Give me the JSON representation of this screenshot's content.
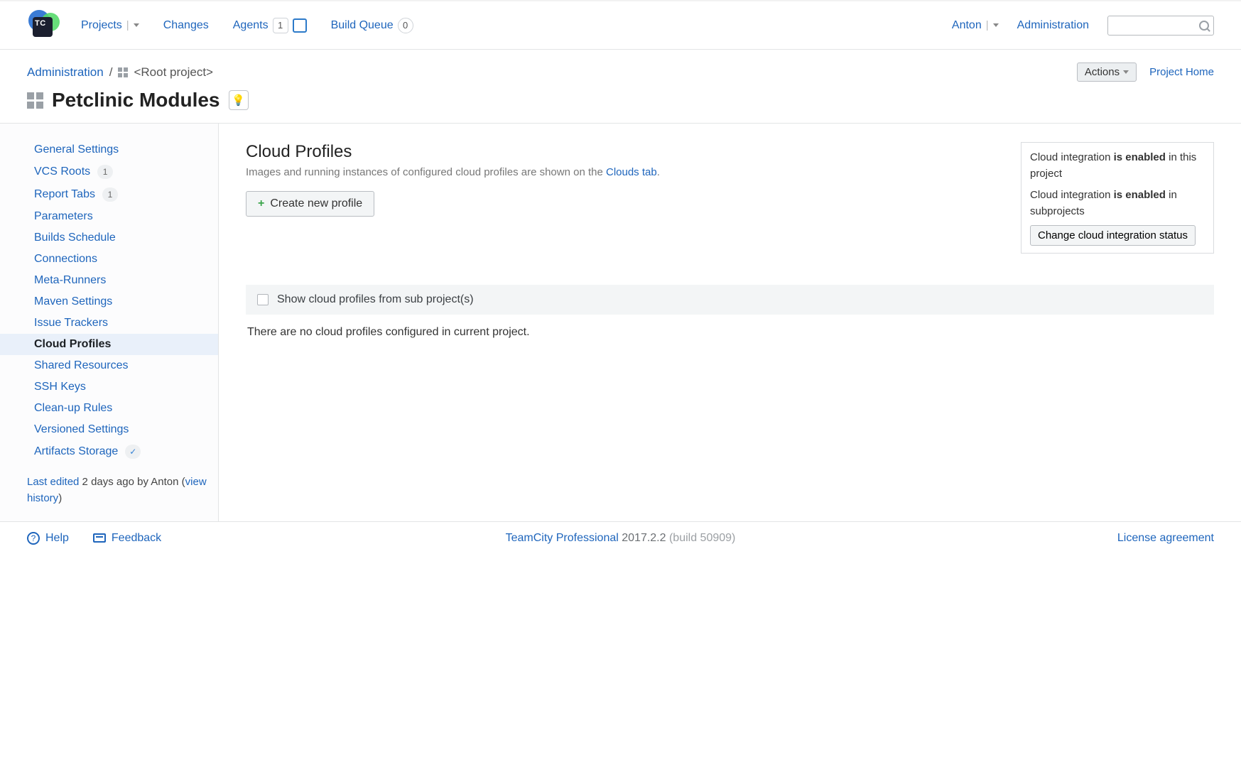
{
  "nav": {
    "projects": "Projects",
    "changes": "Changes",
    "agents": "Agents",
    "agents_count": "1",
    "build_queue": "Build Queue",
    "build_queue_count": "0",
    "user": "Anton",
    "administration": "Administration"
  },
  "breadcrumb": {
    "admin": "Administration",
    "root": "<Root project>",
    "actions": "Actions",
    "project_home": "Project Home"
  },
  "page_title": "Petclinic Modules",
  "sidebar": {
    "items": [
      {
        "label": "General Settings",
        "badge": ""
      },
      {
        "label": "VCS Roots",
        "badge": "1"
      },
      {
        "label": "Report Tabs",
        "badge": "1"
      },
      {
        "label": "Parameters",
        "badge": ""
      },
      {
        "label": "Builds Schedule",
        "badge": ""
      },
      {
        "label": "Connections",
        "badge": ""
      },
      {
        "label": "Meta-Runners",
        "badge": ""
      },
      {
        "label": "Maven Settings",
        "badge": ""
      },
      {
        "label": "Issue Trackers",
        "badge": ""
      },
      {
        "label": "Cloud Profiles",
        "badge": "",
        "active": true
      },
      {
        "label": "Shared Resources",
        "badge": ""
      },
      {
        "label": "SSH Keys",
        "badge": ""
      },
      {
        "label": "Clean-up Rules",
        "badge": ""
      },
      {
        "label": "Versioned Settings",
        "badge": ""
      },
      {
        "label": "Artifacts Storage",
        "badge": "✓"
      }
    ],
    "last_edited": "Last edited",
    "last_edited_suffix": " 2 days ago by Anton (",
    "view_history": "view history",
    "close_paren": ")"
  },
  "main": {
    "title": "Cloud Profiles",
    "subtitle_prefix": "Images and running instances of configured cloud profiles are shown on the ",
    "subtitle_link": "Clouds tab",
    "subtitle_suffix": ".",
    "create_btn": "Create new profile",
    "info_line1_a": "Cloud integration ",
    "info_line1_b": "is enabled",
    "info_line1_c": " in this project",
    "info_line2_a": "Cloud integration ",
    "info_line2_b": "is enabled",
    "info_line2_c": " in subprojects",
    "change_btn": "Change cloud integration status",
    "filter_label": "Show cloud profiles from sub project(s)",
    "empty": "There are no cloud profiles configured in current project."
  },
  "footer": {
    "help": "Help",
    "feedback": "Feedback",
    "product": "TeamCity Professional",
    "version": " 2017.2.2 ",
    "build": "(build 50909)",
    "license": "License agreement"
  }
}
